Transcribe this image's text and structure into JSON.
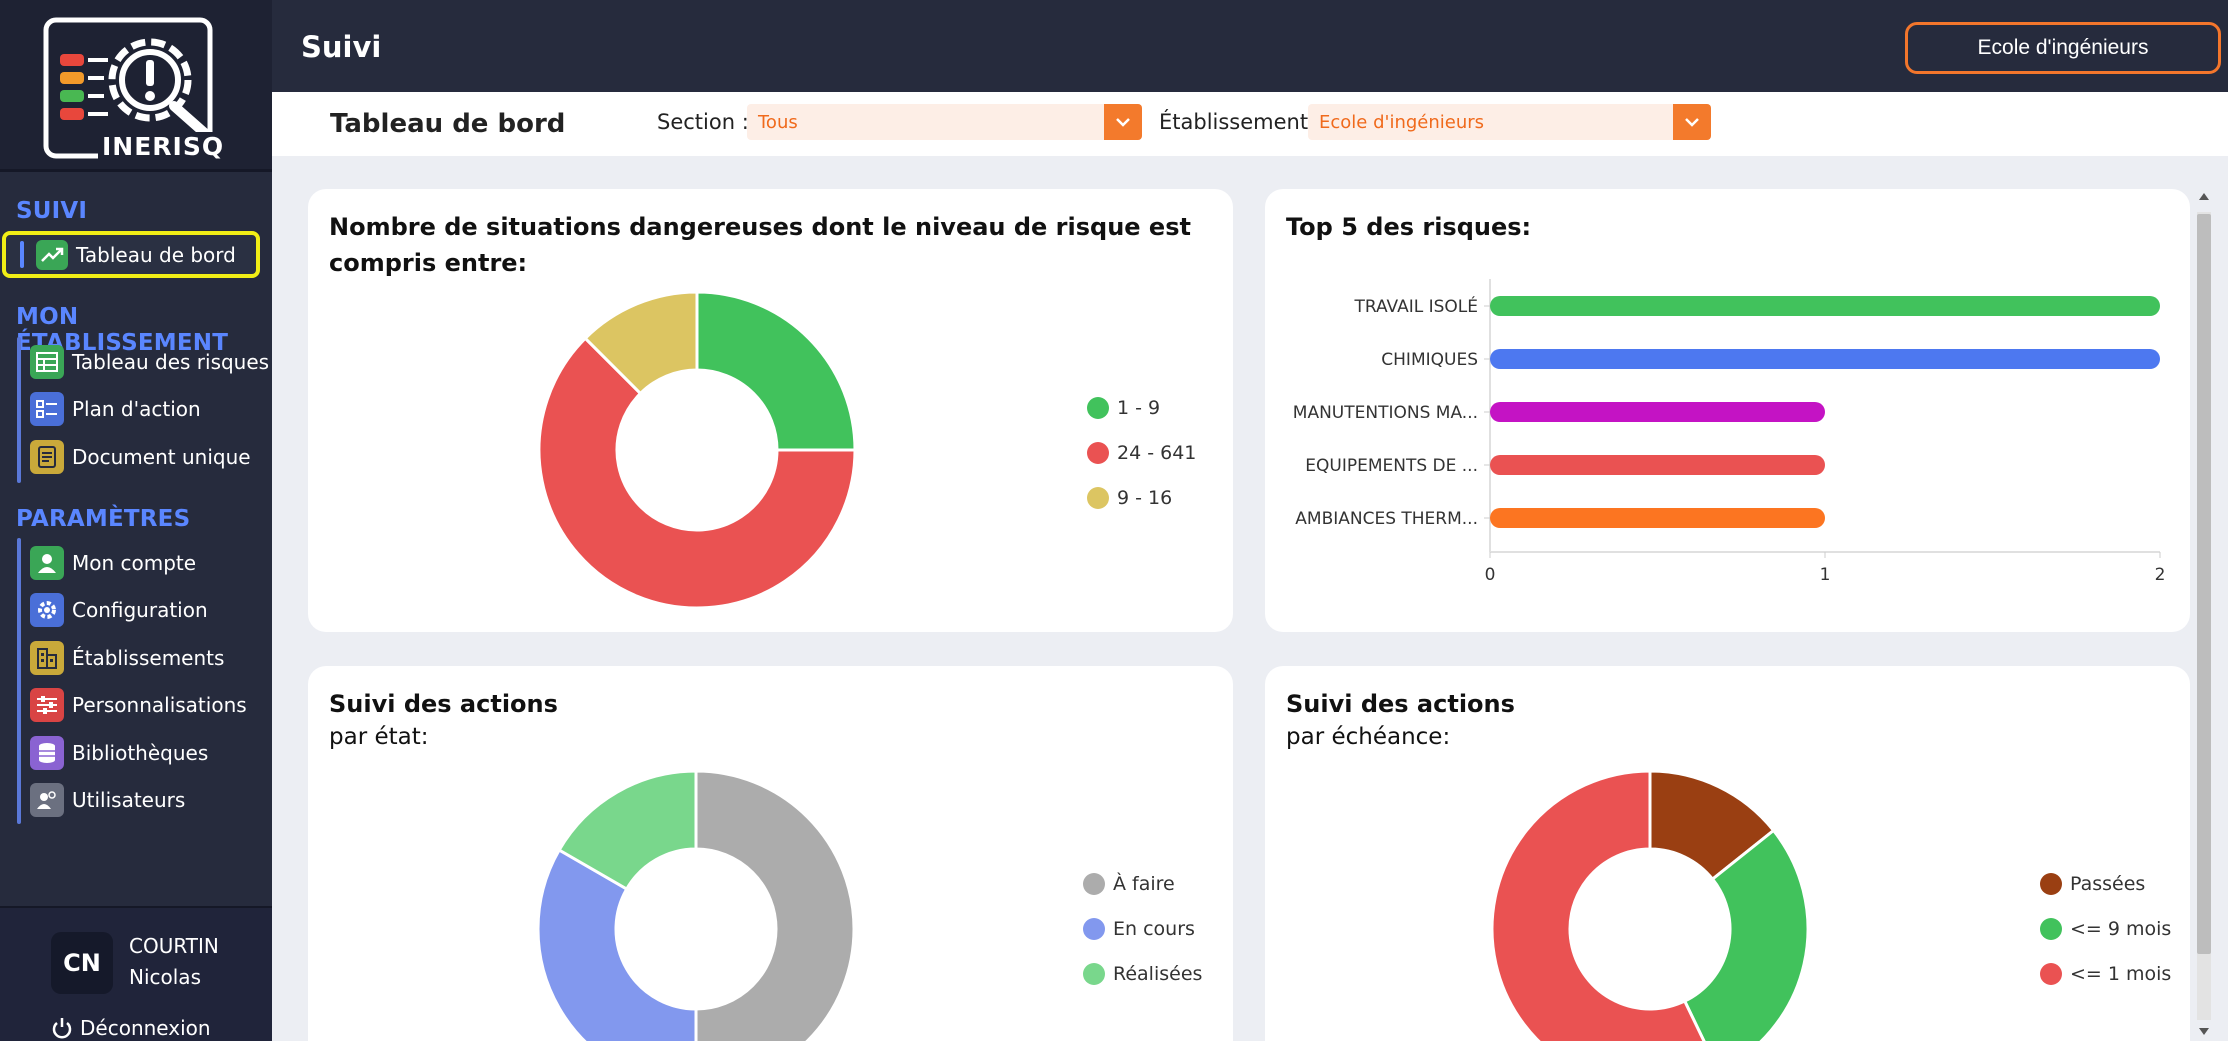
{
  "app": {
    "logo_text": "INERISQ"
  },
  "header": {
    "title": "Suivi",
    "establishment_button": "Ecole d'ingénieurs"
  },
  "filters": {
    "heading": "Tableau de bord",
    "section_label": "Section :",
    "section_value": "Tous",
    "establishment_label": "Établissement :",
    "establishment_value": "Ecole d'ingénieurs"
  },
  "sidebar": {
    "sections": [
      {
        "title": "SUIVI",
        "items": [
          {
            "label": "Tableau de bord",
            "icon": "trend-chart-icon",
            "color": "#3aa656",
            "active": true
          }
        ]
      },
      {
        "title": "MON ÉTABLISSEMENT",
        "items": [
          {
            "label": "Tableau des risques",
            "icon": "table-icon",
            "color": "#3aa656"
          },
          {
            "label": "Plan d'action",
            "icon": "checklist-icon",
            "color": "#4a6fd8"
          },
          {
            "label": "Document unique",
            "icon": "document-icon",
            "color": "#c9a93a"
          }
        ]
      },
      {
        "title": "PARAMÈTRES",
        "items": [
          {
            "label": "Mon compte",
            "icon": "user-icon",
            "color": "#3aa656"
          },
          {
            "label": "Configuration",
            "icon": "gear-icon",
            "color": "#4a6fd8"
          },
          {
            "label": "Établissements",
            "icon": "building-icon",
            "color": "#c9a93a"
          },
          {
            "label": "Personnalisations",
            "icon": "sliders-icon",
            "color": "#d94444"
          },
          {
            "label": "Bibliothèques",
            "icon": "database-icon",
            "color": "#8a63d2"
          },
          {
            "label": "Utilisateurs",
            "icon": "users-icon",
            "color": "#6b7080"
          }
        ]
      }
    ],
    "user": {
      "initials": "CN",
      "last_name": "COURTIN",
      "first_name": "Nicolas"
    },
    "logout_label": "Déconnexion"
  },
  "cards": {
    "risk_levels": {
      "title": "Nombre de situations dangereuses dont le niveau de risque est compris entre:",
      "legend": [
        {
          "label": "1 - 9",
          "color": "#41c25c"
        },
        {
          "label": "24 - 641",
          "color": "#ea5252"
        },
        {
          "label": "9 - 16",
          "color": "#dcc562"
        }
      ]
    },
    "top5": {
      "title": "Top 5 des risques:"
    },
    "actions_state": {
      "title": "Suivi des actions",
      "subtitle": "par état:",
      "legend": [
        {
          "label": "À faire",
          "color": "#acacac"
        },
        {
          "label": "En cours",
          "color": "#8298ee"
        },
        {
          "label": "Réalisées",
          "color": "#79d78c"
        }
      ]
    },
    "actions_deadline": {
      "title": "Suivi des actions",
      "subtitle": "par échéance:",
      "legend": [
        {
          "label": "Passées",
          "color": "#9a3f12"
        },
        {
          "label": "<= 9 mois",
          "color": "#41c25c"
        },
        {
          "label": "<= 1 mois",
          "color": "#ea5252"
        }
      ]
    }
  },
  "chart_data": [
    {
      "type": "pie",
      "donut": true,
      "categories": [
        "1 - 9",
        "24 - 641",
        "9 - 16"
      ],
      "values": [
        2,
        5,
        1
      ],
      "colors": [
        "#41c25c",
        "#ea5252",
        "#dcc562"
      ]
    },
    {
      "type": "bar",
      "orientation": "horizontal",
      "title": "Top 5 des risques:",
      "categories": [
        "TRAVAIL ISOLÉ",
        "CHIMIQUES",
        "MANUTENTIONS MA...",
        "EQUIPEMENTS DE ...",
        "AMBIANCES THERM..."
      ],
      "values": [
        2,
        2,
        1,
        1,
        1
      ],
      "colors": [
        "#41c25c",
        "#4d78f0",
        "#c413c4",
        "#ea5252",
        "#fc7521"
      ],
      "xticks": [
        "0",
        "1",
        "2"
      ],
      "xlim": [
        0,
        2
      ]
    },
    {
      "type": "pie",
      "donut": true,
      "categories": [
        "À faire",
        "En cours",
        "Réalisées"
      ],
      "values": [
        3,
        2,
        1
      ],
      "colors": [
        "#acacac",
        "#8298ee",
        "#79d78c"
      ]
    },
    {
      "type": "pie",
      "donut": true,
      "categories": [
        "Passées",
        "<= 9 mois",
        "<= 1 mois"
      ],
      "values": [
        1,
        2,
        4
      ],
      "colors": [
        "#9a3f12",
        "#41c25c",
        "#ea5252"
      ]
    }
  ]
}
